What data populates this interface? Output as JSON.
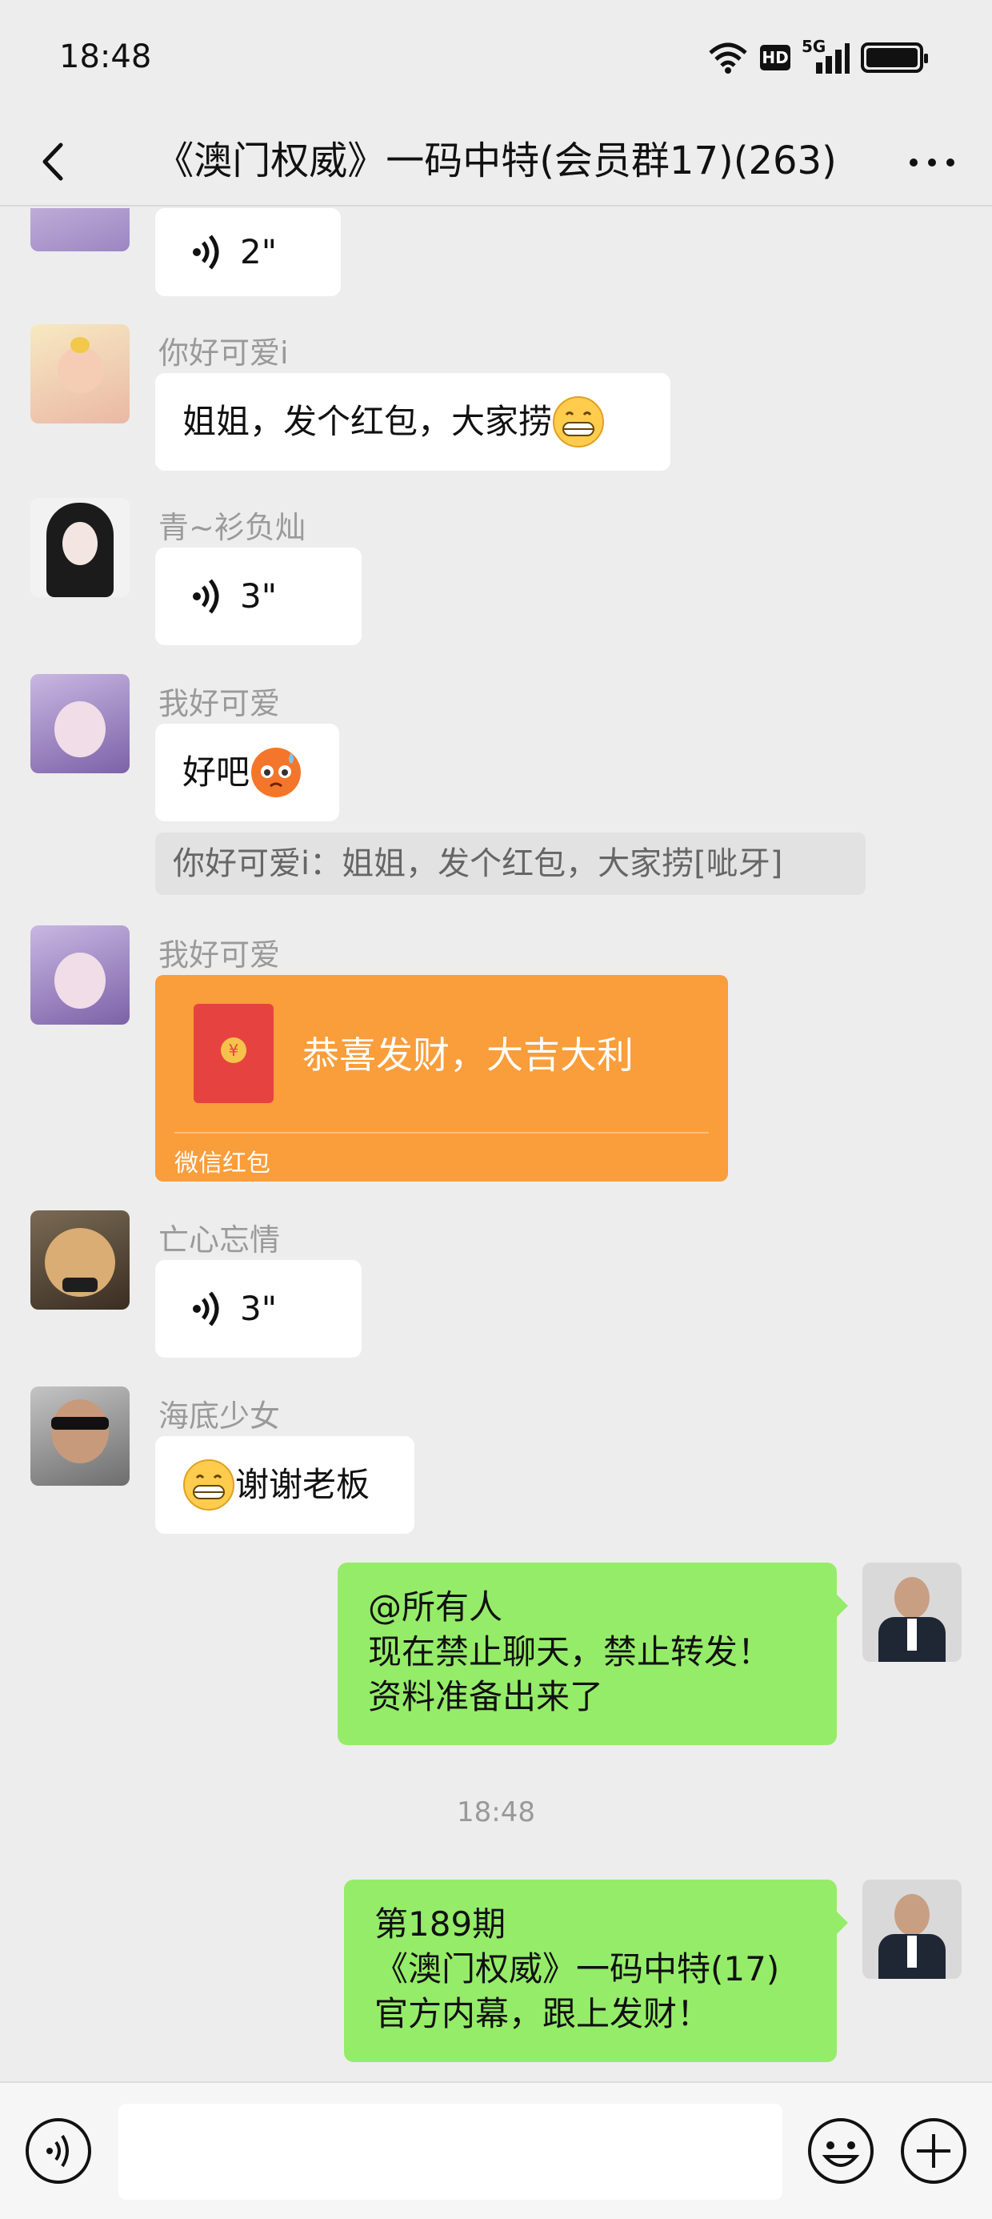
{
  "status_bar": {
    "time": "18:48",
    "hd_label": "HD",
    "network_label": "5G"
  },
  "nav": {
    "title": "《澳门权威》一码中特(会员群17)(263)"
  },
  "messages": [
    {
      "type": "voice",
      "duration": "2\""
    },
    {
      "sender": "你好可爱i",
      "type": "text",
      "text": "姐姐，发个红包，大家捞"
    },
    {
      "sender": "青~衫负灿",
      "type": "voice",
      "duration": "3\""
    },
    {
      "sender": "我好可爱",
      "type": "text",
      "text": "好吧"
    },
    {
      "type": "quote",
      "text": "你好可爱i：姐姐，发个红包，大家捞[呲牙]"
    },
    {
      "sender": "我好可爱",
      "type": "red_packet",
      "title": "恭喜发财，大吉大利",
      "footer": "微信红包"
    },
    {
      "sender": "亡心忘情",
      "type": "voice",
      "duration": "3\""
    },
    {
      "sender": "海底少女",
      "type": "text",
      "text": "谢谢老板"
    },
    {
      "type": "self_text",
      "text": "@所有人\n现在禁止聊天，禁止转发！\n资料准备出来了"
    },
    {
      "type": "timestamp",
      "text": "18:48"
    },
    {
      "type": "self_text",
      "text": "第189期\n《澳门权威》一码中特(17)\n官方内幕，跟上发财！"
    }
  ],
  "colors": {
    "background": "#ededed",
    "self_bubble": "#95ec69",
    "red_packet": "#fa9d3b"
  }
}
